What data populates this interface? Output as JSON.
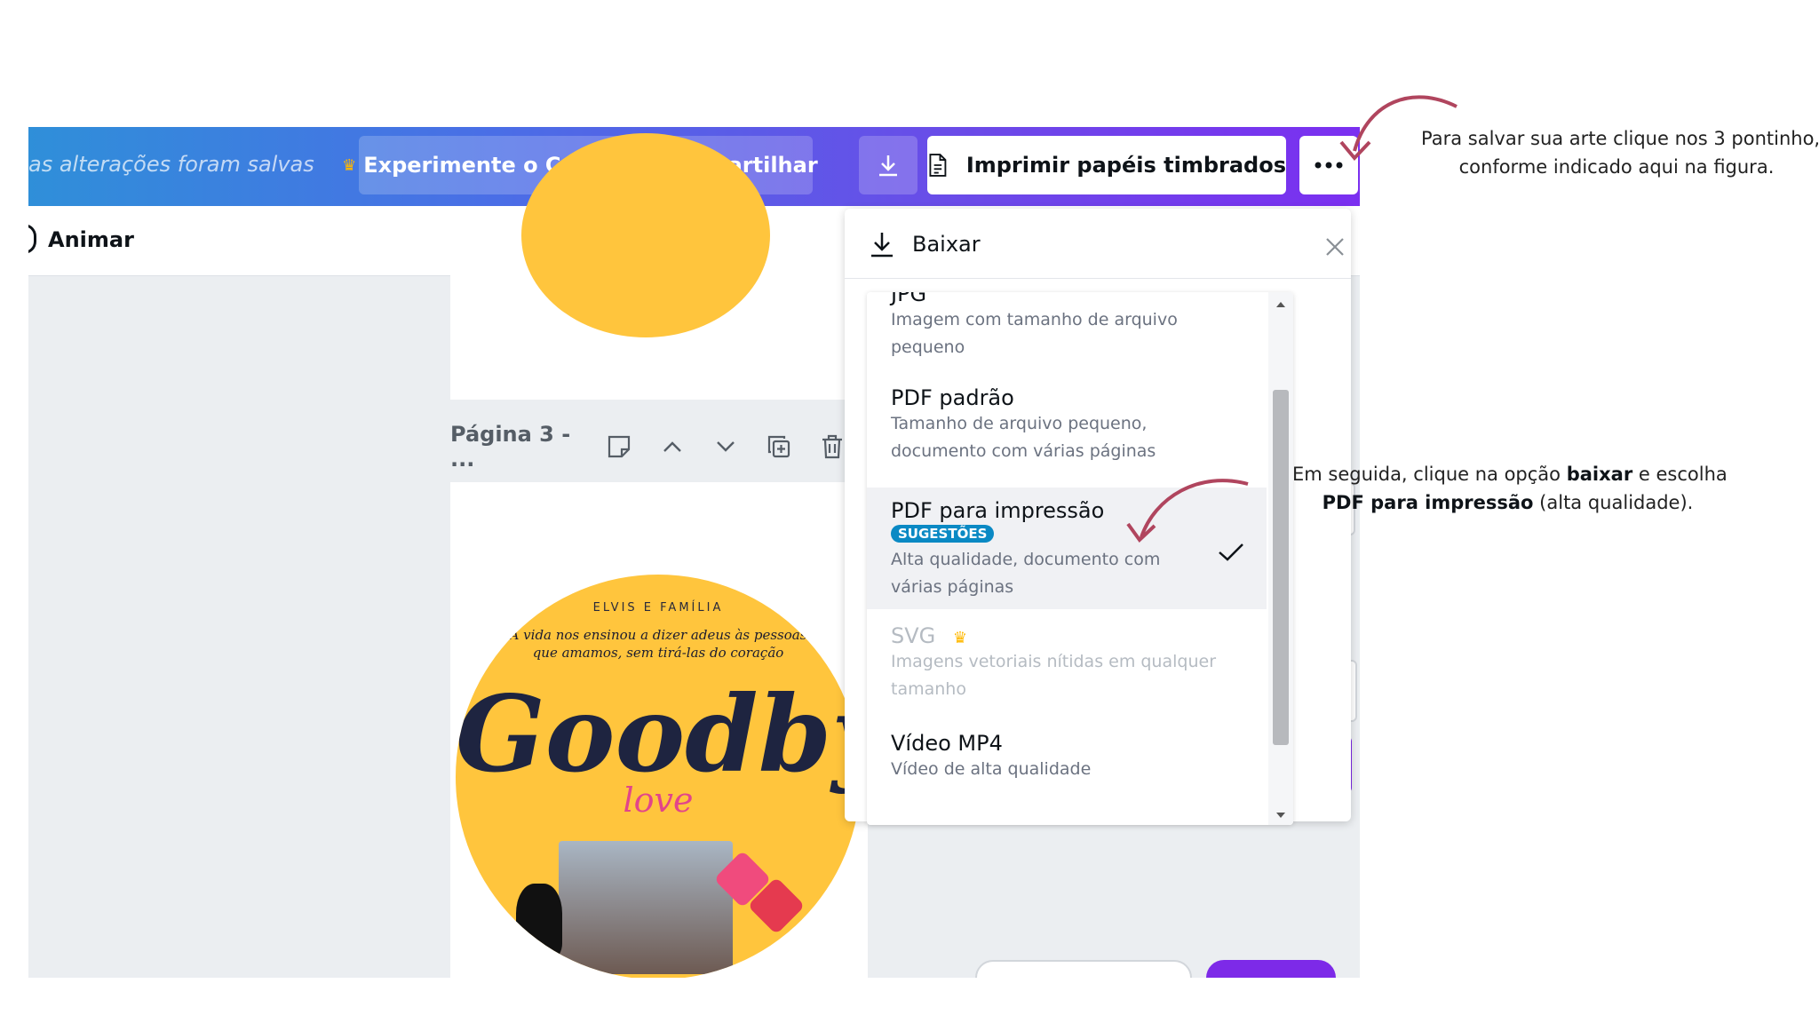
{
  "topbar": {
    "saved_text": "as alterações foram salvas",
    "pro_button": "Experimente o Canva Pro",
    "share_button": "Compartilhar",
    "print_button": "Imprimir papéis timbrados",
    "more_icon": "more-icon",
    "download_icon": "download-icon"
  },
  "subbar": {
    "animate_label": "Animar"
  },
  "page": {
    "title": "Página 3 - ..."
  },
  "design": {
    "small_text": "ELVIS E FAMÍLIA",
    "quote": "A vida nos ensinou a dizer adeus às pessoas que amamos, sem tirá-las do coração",
    "title": "Goodbye",
    "subtitle": "love"
  },
  "download_panel": {
    "title": "Baixar",
    "options": [
      {
        "title": "JPG",
        "desc": "Imagem com tamanho de arquivo pequeno"
      },
      {
        "title": "PDF padrão",
        "desc": "Tamanho de arquivo pequeno, documento com várias páginas"
      },
      {
        "title": "PDF para impressão",
        "badge": "SUGESTÕES",
        "desc": "Alta qualidade, documento com várias páginas",
        "selected": true
      },
      {
        "title": "SVG",
        "desc": "Imagens vetoriais nítidas em qualquer tamanho",
        "disabled": true
      },
      {
        "title": "Vídeo MP4",
        "desc": "Vídeo de alta qualidade"
      }
    ]
  },
  "annotations": {
    "note1_line1": "Para salvar sua arte clique nos 3 pontinho,",
    "note1_line2": "conforme indicado aqui na figura.",
    "note2_pre": "Em seguida, clique na opção ",
    "note2_bold1": "baixar",
    "note2_mid": " e escolha",
    "note2_bold2": "PDF para impressão",
    "note2_post": " (alta qualidade)."
  },
  "colors": {
    "accent": "#7d2ae8",
    "badge": "#0a89c4",
    "arrow": "#b0455e"
  }
}
